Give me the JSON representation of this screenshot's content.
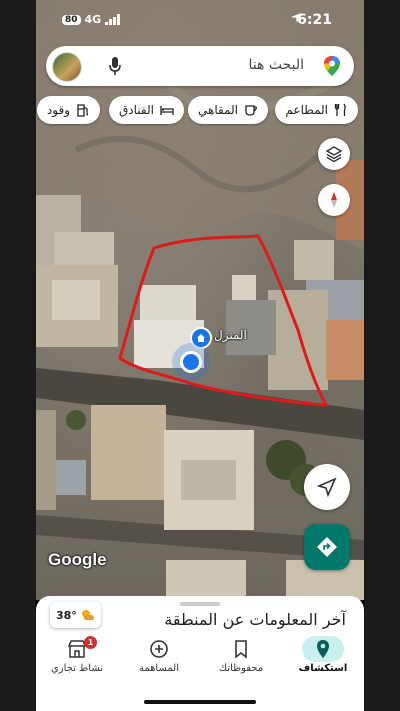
{
  "status": {
    "time": "6:21",
    "network": "4G",
    "badge": "80"
  },
  "search": {
    "placeholder": "البحث هنا"
  },
  "chips": [
    {
      "label": "المطاعم",
      "icon": "fork-knife-icon"
    },
    {
      "label": "المقاهي",
      "icon": "coffee-icon"
    },
    {
      "label": "الفنادق",
      "icon": "bed-icon"
    },
    {
      "label": "وقود",
      "icon": "fuel-icon"
    }
  ],
  "map": {
    "place_label": "المنزل",
    "attribution": "Google",
    "boundary_color": "#e01a1a",
    "location_color": "#1a73e8"
  },
  "sheet": {
    "title": "آخر المعلومات عن المنطقة",
    "weather": "38°"
  },
  "nav": {
    "items": [
      {
        "label": "استكشاف",
        "icon": "location-pin-icon",
        "active": true
      },
      {
        "label": "محفوظاتك",
        "icon": "bookmark-icon"
      },
      {
        "label": "المساهمة",
        "icon": "add-circle-icon"
      },
      {
        "label": "نشاط تجاري",
        "icon": "store-icon",
        "badge": "1"
      }
    ]
  },
  "accent": "#00796b"
}
